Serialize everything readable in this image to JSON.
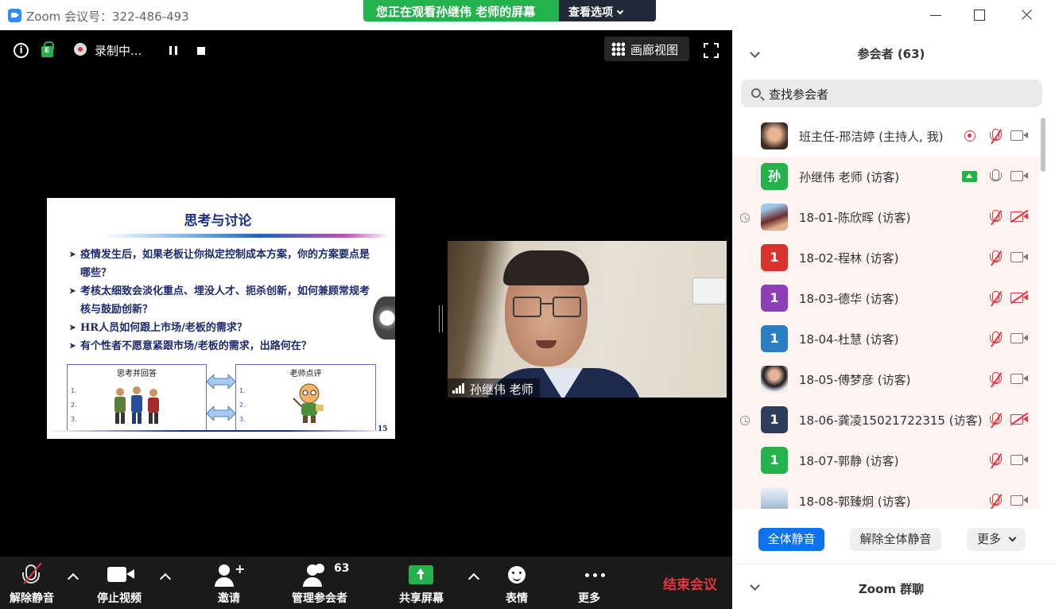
{
  "window": {
    "title": "Zoom 会议号：322-486-493",
    "share_banner": "您正在观看孙继伟 老师的屏幕",
    "view_options": "查看选项"
  },
  "meeting_bar": {
    "recording_label": "录制中...",
    "gallery_label": "画廊视图"
  },
  "slide": {
    "title": "思考与讨论",
    "bullets": [
      "疫情发生后，如果老板让你拟定控制成本方案，你的方案要点是哪些？",
      "考核太细致会淡化重点、埋没人才、扼杀创新，如何兼顾常规考核与鼓励创新？",
      "HR人员如何跟上市场/老板的需求？",
      "有个性者不愿意紧跟市场/老板的需求，出路何在？"
    ],
    "left_box_caption": "思考并回答",
    "right_box_caption": "老师点评",
    "numbers": [
      "1.",
      "2.",
      "3."
    ],
    "page_number": "15"
  },
  "video": {
    "speaker_name": "孙继伟 老师"
  },
  "toolbar": {
    "unmute": "解除静音",
    "stop_video": "停止视频",
    "invite": "邀请",
    "manage_participants": "管理参会者",
    "participant_count": "63",
    "share_screen": "共享屏幕",
    "reactions": "表情",
    "more": "更多",
    "end_meeting": "结束会议"
  },
  "panel": {
    "title": "参会者 (63)",
    "search_placeholder": "查找参会者",
    "participants": [
      {
        "name": "班主任-邢洁婷 (主持人, 我)",
        "avatar": "photo",
        "mic": "muted",
        "video": "on",
        "recording": true
      },
      {
        "name": "孙继伟 老师 (访客)",
        "avatar": "孙",
        "avatar_color": "#23b24c",
        "mic": "on",
        "video": "on",
        "sharing": true
      },
      {
        "name": "18-01-陈欣晖 (访客)",
        "avatar": "photo",
        "mic": "muted",
        "video": "off",
        "waiting": true
      },
      {
        "name": "18-02-程林 (访客)",
        "avatar": "1",
        "avatar_color": "#d9312b",
        "mic": "muted",
        "video": "on"
      },
      {
        "name": "18-03-德华 (访客)",
        "avatar": "1",
        "avatar_color": "#8d3fb8",
        "mic": "muted",
        "video": "off"
      },
      {
        "name": "18-04-杜慧 (访客)",
        "avatar": "1",
        "avatar_color": "#2a7fc4",
        "mic": "muted",
        "video": "on"
      },
      {
        "name": "18-05-傅梦彦 (访客)",
        "avatar": "photo",
        "mic": "muted",
        "video": "on"
      },
      {
        "name": "18-06-龚凌15021722315 (访客)",
        "avatar": "1",
        "avatar_color": "#2c3e5a",
        "mic": "muted",
        "video": "off",
        "waiting": true
      },
      {
        "name": "18-07-郭静 (访客)",
        "avatar": "1",
        "avatar_color": "#23b24c",
        "mic": "muted",
        "video": "on"
      },
      {
        "name": "18-08-郭臻炯 (访客)",
        "avatar": "photo",
        "mic": "muted",
        "video": "on"
      }
    ],
    "mute_all": "全体静音",
    "unmute_all": "解除全体静音",
    "more": "更多",
    "chat_title": "Zoom 群聊"
  }
}
